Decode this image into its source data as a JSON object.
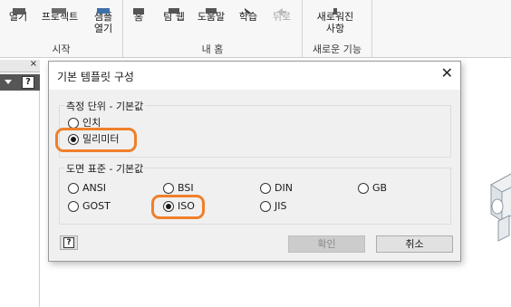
{
  "ribbon": {
    "start_group": {
      "label": "시작",
      "buttons": [
        {
          "label": "열기"
        },
        {
          "label": "프로젝트"
        },
        {
          "label_line1": "샘플",
          "label_line2": "열기"
        }
      ]
    },
    "home_group": {
      "label": "내 홈",
      "buttons": [
        {
          "label": "홈"
        },
        {
          "label": "팀 웹"
        },
        {
          "label": "도움말"
        },
        {
          "label": "학습"
        },
        {
          "label": "뒤로"
        }
      ]
    },
    "new_group": {
      "label": "새로운 기능",
      "buttons": [
        {
          "label_line1": "새로워진",
          "label_line2": "사항"
        }
      ]
    }
  },
  "left_pane": {
    "close_glyph": "×",
    "help_glyph": "?"
  },
  "dialog": {
    "title": "기본 템플릿 구성",
    "close_glyph": "✕",
    "units_group": {
      "title": "측정 단위 - 기본값",
      "options": [
        {
          "label": "인치",
          "selected": false
        },
        {
          "label": "밀리미터",
          "selected": true
        }
      ]
    },
    "standard_group": {
      "title": "도면 표준 - 기본값",
      "options": [
        {
          "label": "ANSI",
          "selected": false
        },
        {
          "label": "BSI",
          "selected": false
        },
        {
          "label": "DIN",
          "selected": false
        },
        {
          "label": "GB",
          "selected": false
        },
        {
          "label": "GOST",
          "selected": false
        },
        {
          "label": "ISO",
          "selected": true
        },
        {
          "label": "JIS",
          "selected": false
        }
      ]
    },
    "help_glyph": "?",
    "ok_label": "확인",
    "ok_enabled": false,
    "cancel_label": "취소"
  },
  "colors": {
    "highlight": "#f07f2a",
    "dialog_client": "#f0f0f0",
    "ribbon_bg": "#f7f7f7"
  }
}
